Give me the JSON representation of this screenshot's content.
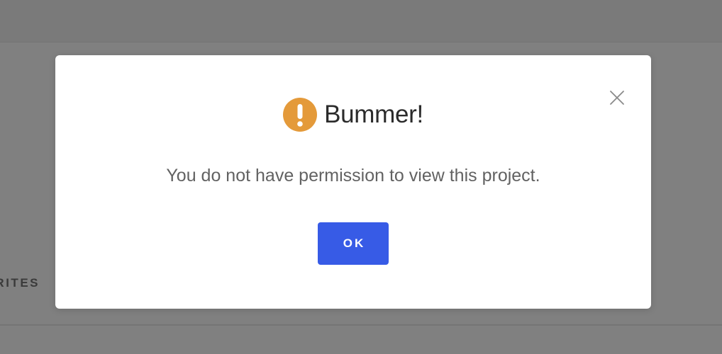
{
  "background": {
    "section_label": "FAVORITES"
  },
  "modal": {
    "title": "Bummer!",
    "message": "You do not have permission to view this project.",
    "ok_label": "OK",
    "icon": "exclamation-circle-icon",
    "close_icon": "close-icon"
  },
  "colors": {
    "warning": "#E49A3A",
    "primary_button": "#375BE6",
    "overlay": "#7F7F7F"
  }
}
